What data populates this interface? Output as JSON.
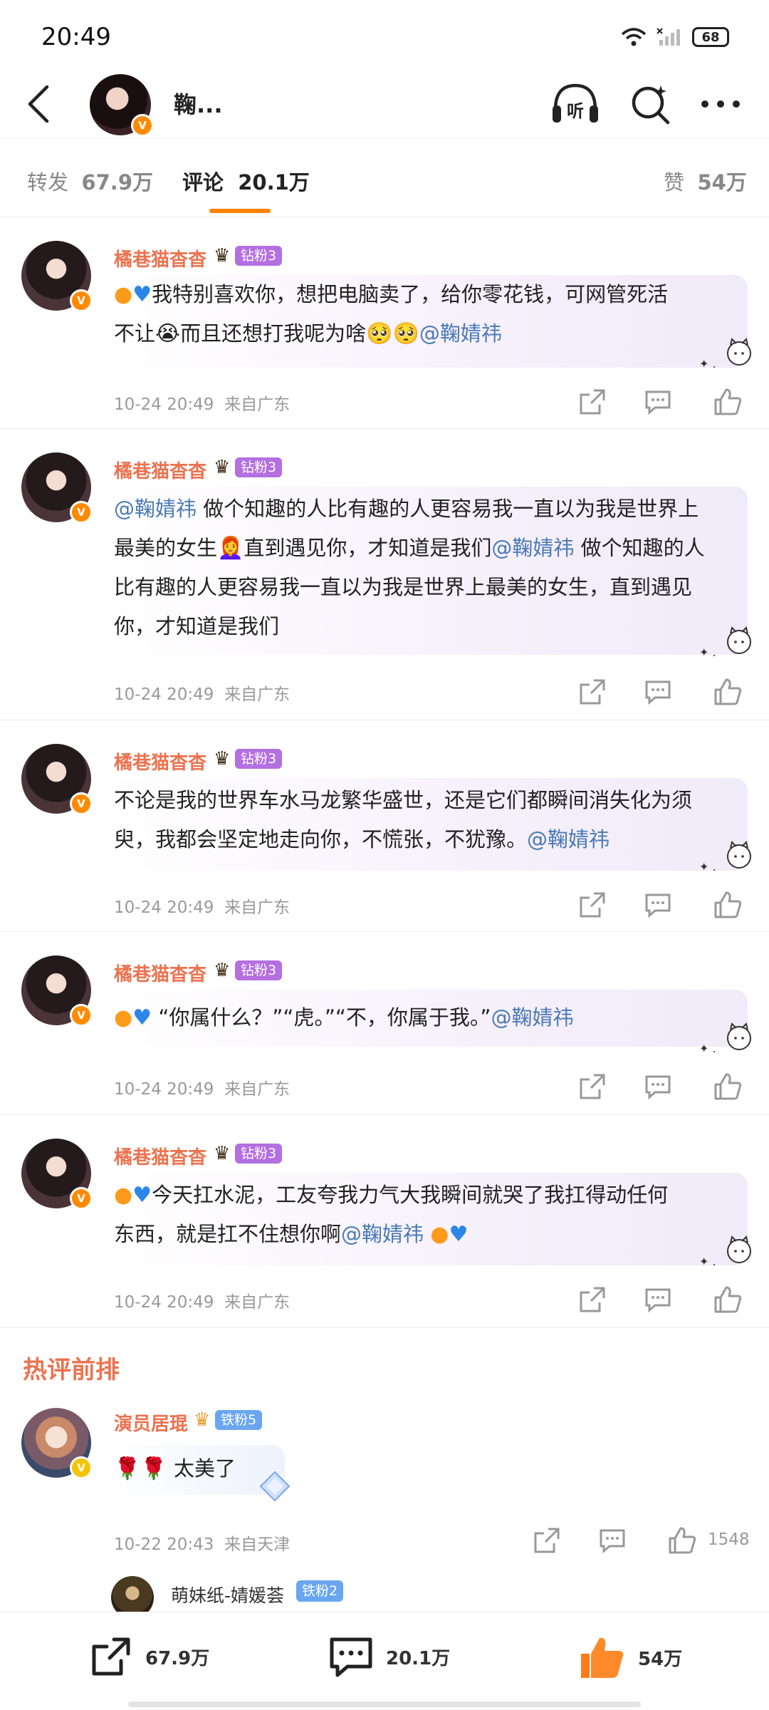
{
  "status_bar": {
    "time": "20:49",
    "battery": "68"
  },
  "header": {
    "name": "鞠...",
    "listen_label": "听"
  },
  "tabs": [
    {
      "label": "转发",
      "count": "67.9万"
    },
    {
      "label": "评论",
      "count": "20.1万"
    },
    {
      "label": "赞",
      "count": "54万"
    }
  ],
  "comments": [
    {
      "user": "橘巷猫杳杳",
      "badge": "钻粉3",
      "text_a": "我特别喜欢你，想把电脑卖了，给你零花钱，可网管死活",
      "text_b": "不让",
      "text_c": "而且还想打我呢为啥",
      "mention": "@鞠婧祎",
      "time": "10-24 20:49",
      "location": "来自广东"
    },
    {
      "user": "橘巷猫杳杳",
      "badge": "钻粉3",
      "mention": "@鞠婧祎",
      "text_a": " 做个知趣的人比有趣的人更容易我一直以为我是世界上",
      "text_b": "最美的女生",
      "text_c": "直到遇见你，才知道是我们",
      "mention2": "@鞠婧祎",
      "text_d": " 做个知趣的人",
      "text_e": "比有趣的人更容易我一直以为我是世界上最美的女生，直到遇见",
      "text_f": "你，才知道是我们",
      "time": "10-24 20:49",
      "location": "来自广东"
    },
    {
      "user": "橘巷猫杳杳",
      "badge": "钻粉3",
      "text_a": "不论是我的世界车水马龙繁华盛世，还是它们都瞬间消失化为须",
      "text_b": "臾，我都会坚定地走向你，不慌张，不犹豫。",
      "mention": "@鞠婧祎",
      "time": "10-24 20:49",
      "location": "来自广东"
    },
    {
      "user": "橘巷猫杳杳",
      "badge": "钻粉3",
      "text_a": "“你属什么？”“虎。”“不，你属于我。”",
      "mention": "@鞠婧祎",
      "time": "10-24 20:49",
      "location": "来自广东"
    },
    {
      "user": "橘巷猫杳杳",
      "badge": "钻粉3",
      "text_a": "今天扛水泥，工友夸我力气大我瞬间就哭了我扛得动任何",
      "text_b": "东西，就是扛不住想你啊",
      "mention": "@鞠婧祎",
      "time": "10-24 20:49",
      "location": "来自广东"
    }
  ],
  "hot_title": "热评前排",
  "hot_comment": {
    "user": "演员居琨",
    "badge": "铁粉5",
    "text": "太美了",
    "time": "10-22 20:43",
    "location": "来自天津",
    "likes": "1548"
  },
  "reply_preview": {
    "user": "萌妹纸-婧媛荟",
    "badge": "铁粉2"
  },
  "bottom_bar": {
    "repost": "67.9万",
    "comment": "20.1万",
    "like": "54万"
  },
  "colors": {
    "accent": "#ff8200",
    "username": "#eb7350",
    "mention": "#4b7ab6"
  }
}
